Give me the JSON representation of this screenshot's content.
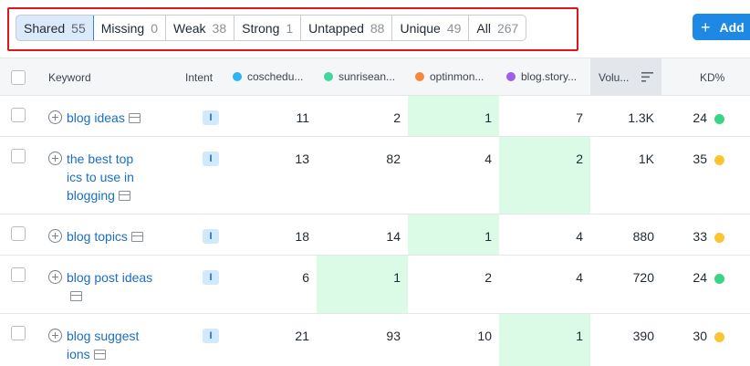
{
  "filters": [
    {
      "label": "Shared",
      "count": "55",
      "active": true
    },
    {
      "label": "Missing",
      "count": "0"
    },
    {
      "label": "Weak",
      "count": "38"
    },
    {
      "label": "Strong",
      "count": "1"
    },
    {
      "label": "Untapped",
      "count": "88"
    },
    {
      "label": "Unique",
      "count": "49"
    },
    {
      "label": "All",
      "count": "267"
    }
  ],
  "add_button": {
    "label": "Add",
    "icon": "plus-icon"
  },
  "columns": {
    "keyword": "Keyword",
    "intent": "Intent",
    "competitors": [
      {
        "label": "coschedu...",
        "color": "#2bb5f2"
      },
      {
        "label": "sunrisean...",
        "color": "#3fd6a0"
      },
      {
        "label": "optinmon...",
        "color": "#f5883a"
      },
      {
        "label": "blog.story...",
        "color": "#a15ee8"
      }
    ],
    "volume": "Volu...",
    "kd": "KD%"
  },
  "colors": {
    "highlight": "#dcfbe6",
    "kd_green": "#38d487",
    "kd_yellow": "#fbc531",
    "accent": "#1e88e5"
  },
  "rows": [
    {
      "keyword": "blog ideas",
      "intent": "I",
      "values": [
        "11",
        "2",
        "1",
        "7"
      ],
      "highlight": 2,
      "volume": "1.3K",
      "kd": "24",
      "kd_color": "green"
    },
    {
      "keyword": "the best topics to use in blogging",
      "intent": "I",
      "values": [
        "13",
        "82",
        "4",
        "2"
      ],
      "highlight": 3,
      "volume": "1K",
      "kd": "35",
      "kd_color": "yellow"
    },
    {
      "keyword": "blog topics",
      "intent": "I",
      "values": [
        "18",
        "14",
        "1",
        "4"
      ],
      "highlight": 2,
      "volume": "880",
      "kd": "33",
      "kd_color": "yellow"
    },
    {
      "keyword": "blog post ideas",
      "intent": "I",
      "values": [
        "6",
        "1",
        "2",
        "4"
      ],
      "highlight": 1,
      "volume": "720",
      "kd": "24",
      "kd_color": "green"
    },
    {
      "keyword": "blog suggestions",
      "intent": "I",
      "values": [
        "21",
        "93",
        "10",
        "1"
      ],
      "highlight": 3,
      "volume": "390",
      "kd": "30",
      "kd_color": "yellow"
    }
  ]
}
